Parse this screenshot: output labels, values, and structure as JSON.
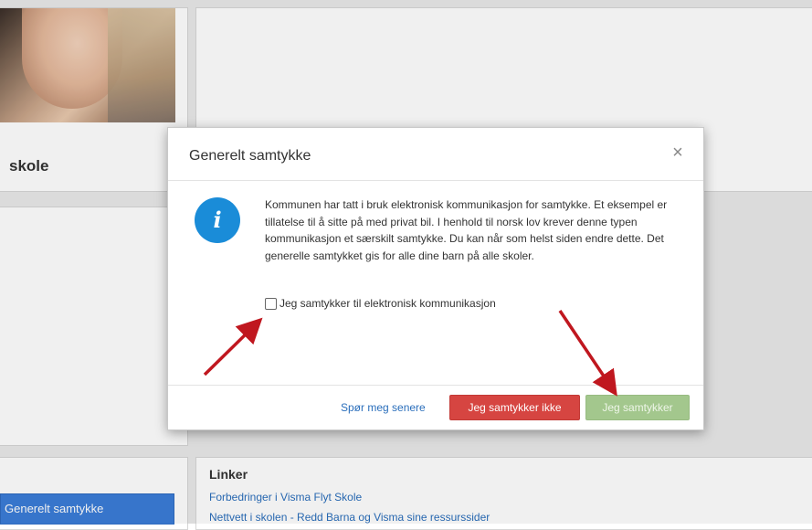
{
  "background": {
    "school_name": "skole",
    "side_button_label": "Generelt samtykke",
    "links": {
      "title": "Linker",
      "items": [
        "Forbedringer i Visma Flyt Skole",
        "Nettvett i skolen - Redd Barna og Visma sine ressurssider"
      ]
    }
  },
  "modal": {
    "title": "Generelt samtykke",
    "close_symbol": "×",
    "info_icon": "info-icon",
    "info_symbol": "i",
    "body_text": "Kommunen har tatt i bruk elektronisk kommunikasjon for samtykke. Et eksempel er tillatelse til å sitte på med privat bil. I henhold til norsk lov krever denne typen kommunikasjon et særskilt samtykke. Du kan når som helst siden endre dette. Det generelle samtykket gis for alle dine barn på alle skoler.",
    "checkbox_label": "Jeg samtykker til elektronisk kommunikasjon",
    "checkbox_checked": false,
    "later_link": "Spør meg senere",
    "decline_button": "Jeg samtykker ikke",
    "accept_button": "Jeg samtykker",
    "accept_enabled": false
  },
  "annotation_color": "#c0171f",
  "colors": {
    "info_blue": "#1a8cd8",
    "decline_red": "#d64541",
    "accept_green_disabled": "#a3c78d",
    "link_blue": "#2a6ebb",
    "side_button_blue": "#3b7dd8"
  }
}
